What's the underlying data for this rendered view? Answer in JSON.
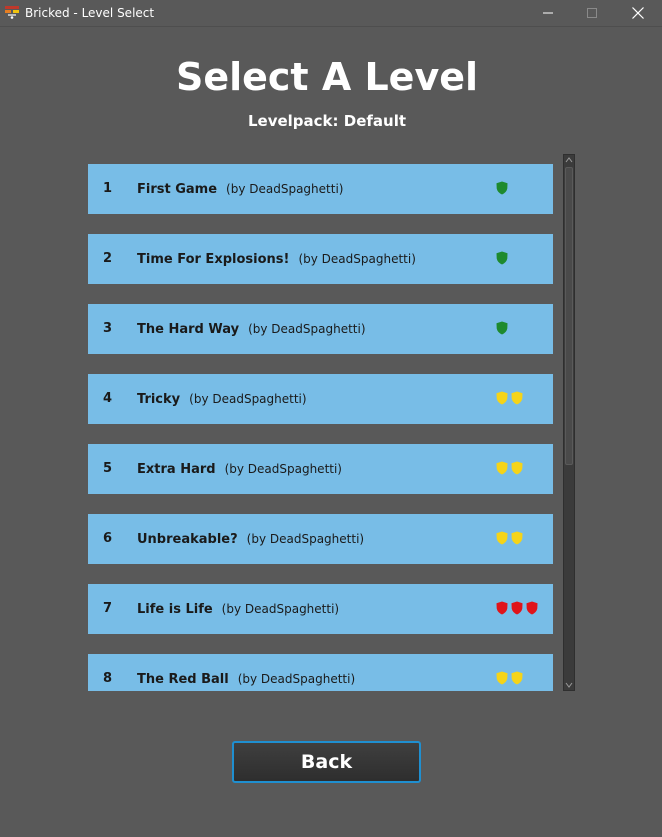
{
  "window": {
    "title": "Bricked - Level Select",
    "icon": "bricked-app-icon",
    "controls": [
      "minimize-icon",
      "maximize-icon",
      "close-icon"
    ]
  },
  "heading": "Select A Level",
  "levelpack_label": "Levelpack: Default",
  "shield_colors": {
    "green": "#1e8a2e",
    "yellow": "#f5d418",
    "red": "#e0141a"
  },
  "levels": [
    {
      "number": "1",
      "name": "First Game",
      "author": "(by DeadSpaghetti)",
      "difficulty": "green",
      "shield_count": 1
    },
    {
      "number": "2",
      "name": "Time For Explosions!",
      "author": "(by DeadSpaghetti)",
      "difficulty": "green",
      "shield_count": 1
    },
    {
      "number": "3",
      "name": "The Hard Way",
      "author": "(by DeadSpaghetti)",
      "difficulty": "green",
      "shield_count": 1
    },
    {
      "number": "4",
      "name": "Tricky",
      "author": "(by DeadSpaghetti)",
      "difficulty": "yellow",
      "shield_count": 2
    },
    {
      "number": "5",
      "name": "Extra Hard",
      "author": "(by DeadSpaghetti)",
      "difficulty": "yellow",
      "shield_count": 2
    },
    {
      "number": "6",
      "name": "Unbreakable?",
      "author": "(by DeadSpaghetti)",
      "difficulty": "yellow",
      "shield_count": 2
    },
    {
      "number": "7",
      "name": "Life is Life",
      "author": "(by DeadSpaghetti)",
      "difficulty": "red",
      "shield_count": 3
    },
    {
      "number": "8",
      "name": "The Red Ball",
      "author": "(by DeadSpaghetti)",
      "difficulty": "yellow",
      "shield_count": 2
    }
  ],
  "back_label": "Back"
}
